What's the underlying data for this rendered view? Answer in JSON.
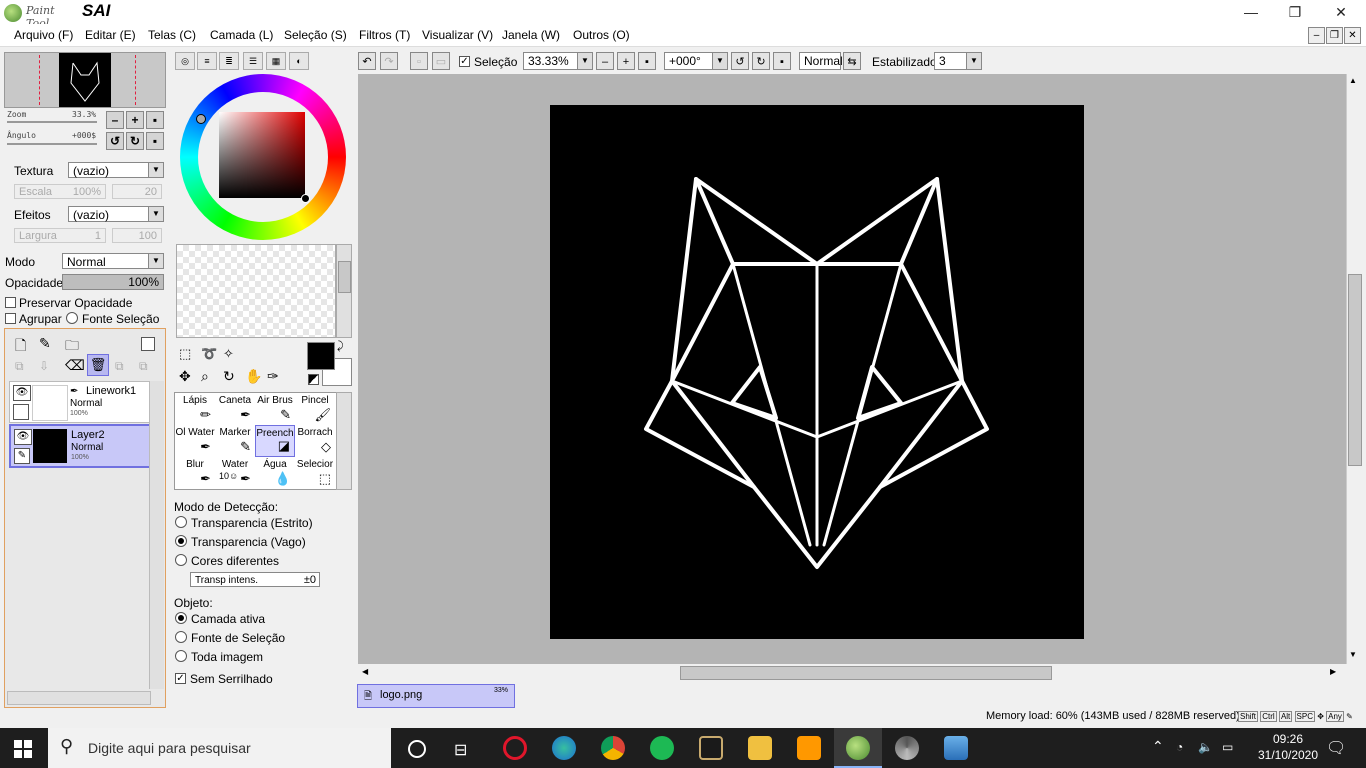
{
  "app": {
    "brand_small": "Paint Tool",
    "brand_big": "SAI"
  },
  "window_controls": {
    "minimize": "—",
    "maximize": "❐",
    "close": "✕"
  },
  "menu": [
    "Arquivo (F)",
    "Editar (E)",
    "Telas (C)",
    "Camada (L)",
    "Seleção (S)",
    "Filtros (T)",
    "Visualizar (V)",
    "Janela (W)",
    "Outros (O)"
  ],
  "navigator": {
    "zoom_label": "Zoom",
    "zoom_value": "33.3%",
    "angle_label": "Ângulo",
    "angle_value": "+000$"
  },
  "texture": {
    "label": "Textura",
    "value": "(vazio)",
    "scale_label": "Escala",
    "scale_value": "100%",
    "scale_num": "20"
  },
  "effects": {
    "label": "Efeitos",
    "value": "(vazio)",
    "width_label": "Largura",
    "width_value": "1",
    "width_num": "100"
  },
  "blend": {
    "mode_label": "Modo",
    "mode_value": "Normal",
    "opacity_label": "Opacidade",
    "opacity_value": "100%",
    "preserve_label": "Preservar Opacidade",
    "group_label": "Agrupar",
    "clip_label": "Fonte Seleção"
  },
  "layers": [
    {
      "name": "Linework1",
      "mode": "Normal",
      "opacity": "100%",
      "selected": false
    },
    {
      "name": "Layer2",
      "mode": "Normal",
      "opacity": "100%",
      "selected": true
    }
  ],
  "tools": [
    {
      "name": "Lápis",
      "icon": "pencil-icon"
    },
    {
      "name": "Caneta",
      "icon": "pen-icon"
    },
    {
      "name": "Air Brus",
      "icon": "airbrush-icon"
    },
    {
      "name": "Pincel",
      "icon": "brush-icon"
    },
    {
      "name": "Ol Water",
      "icon": "oil-water-icon"
    },
    {
      "name": "Marker",
      "icon": "marker-icon"
    },
    {
      "name": "Preench",
      "icon": "bucket-icon",
      "selected": true
    },
    {
      "name": "Borrach",
      "icon": "eraser-icon"
    },
    {
      "name": "Blur",
      "icon": "blur-icon"
    },
    {
      "name": "Water",
      "sub": "10☺",
      "icon": "water-icon"
    },
    {
      "name": "Água",
      "icon": "water-drop-icon"
    },
    {
      "name": "Selecior",
      "icon": "select-pen-icon"
    }
  ],
  "fill_options": {
    "detect_label": "Modo de Detecção:",
    "detect": [
      "Transparencia (Estrito)",
      "Transparencia (Vago)",
      "Cores diferentes"
    ],
    "detect_selected": 1,
    "intensity_label": "Transp intens.",
    "intensity_value": "±0",
    "object_label": "Objeto:",
    "object": [
      "Camada ativa",
      "Fonte de Seleção",
      "Toda imagem"
    ],
    "object_selected": 0,
    "antialias_label": "Sem Serrilhado"
  },
  "canvas_toolbar": {
    "selection_label": "Seleção",
    "zoom": "33.33%",
    "angle": "+000°",
    "mode": "Normal",
    "stabilizer_label": "Estabilizador",
    "stabilizer_value": "3"
  },
  "colors": {
    "primary": "#000000",
    "secondary": "#ffffff",
    "accent_selected": "#c8c8f8",
    "canvas_bg": "#b4b4b4"
  },
  "file_tab": {
    "name": "logo.png",
    "zoom": "33%"
  },
  "status": {
    "memory": "Memory load: 60% (143MB used / 828MB reserved)",
    "keys": [
      "Shift",
      "Ctrl",
      "Alt",
      "SPC",
      "Any"
    ]
  },
  "taskbar": {
    "search_placeholder": "Digite aqui para pesquisar",
    "time": "09:26",
    "date": "31/10/2020"
  }
}
